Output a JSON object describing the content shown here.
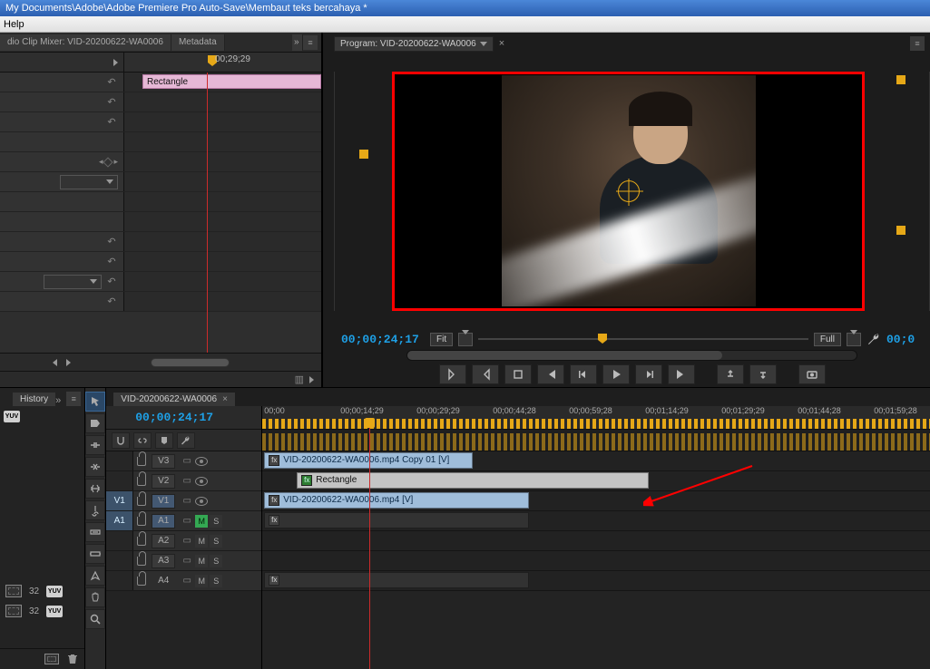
{
  "titlebar": "My Documents\\Adobe\\Adobe Premiere Pro Auto-Save\\Membaut teks bercahaya *",
  "menubar": {
    "help": "Help"
  },
  "effectControls": {
    "tab_mixer": "dio Clip Mixer: VID-20200622-WA0006",
    "tab_metadata": "Metadata",
    "timecode": "00;29;29",
    "clip_name": "Rectangle"
  },
  "program": {
    "tab_label": "Program: VID-20200622-WA0006",
    "current_tc": "00;00;24;17",
    "fit_label": "Fit",
    "full_label": "Full",
    "right_tc": "00;0"
  },
  "history": {
    "tab": "History"
  },
  "yuv": {
    "label": "YUV",
    "count1": "32",
    "count2": "32"
  },
  "timeline": {
    "tab": "VID-20200622-WA0006",
    "current_tc": "00;00;24;17",
    "ruler": [
      "00;00",
      "00;00;14;29",
      "00;00;29;29",
      "00;00;44;28",
      "00;00;59;28",
      "00;01;14;29",
      "00;01;29;29",
      "00;01;44;28",
      "00;01;59;28"
    ],
    "tracks": {
      "v3": "V3",
      "v2": "V2",
      "v1_src": "V1",
      "v1": "V1",
      "a1_src": "A1",
      "a1": "A1",
      "a2": "A2",
      "a3": "A3",
      "a4": "A4",
      "m": "M",
      "s": "S"
    },
    "clips": {
      "v3": "VID-20200622-WA0006.mp4 Copy 01 [V]",
      "v2": "Rectangle",
      "v1": "VID-20200622-WA0006.mp4 [V]"
    },
    "fx": "fx"
  }
}
